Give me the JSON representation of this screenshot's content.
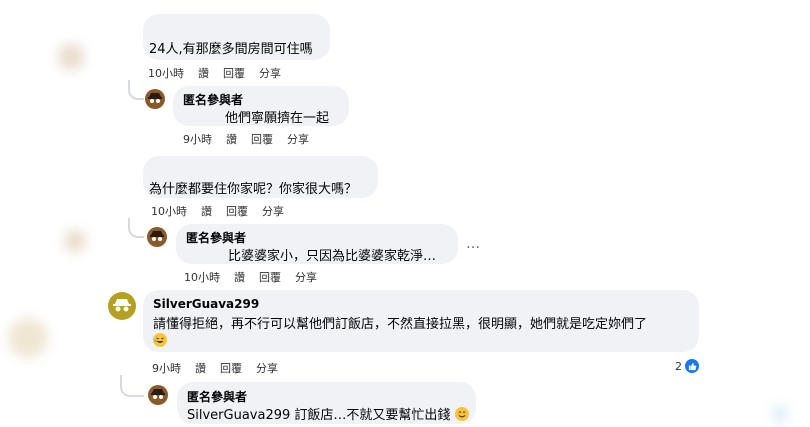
{
  "comments": [
    {
      "text": "24人,有那麼多間房間可住嗎",
      "time": "10小時",
      "like_label": "讚",
      "reply_label": "回覆",
      "share_label": "分享"
    },
    {
      "name": "匿名參與者",
      "text": "他們寧願擠在一起",
      "time": "9小時",
      "like_label": "讚",
      "reply_label": "回覆",
      "share_label": "分享"
    },
    {
      "text": "為什麼都要住你家呢？你家很大嗎？",
      "time": "10小時",
      "like_label": "讚",
      "reply_label": "回覆",
      "share_label": "分享"
    },
    {
      "name": "匿名參與者",
      "text": "比婆婆家小，只因為比婆婆家乾淨…",
      "time": "10小時",
      "like_label": "讚",
      "reply_label": "回覆",
      "share_label": "分享",
      "more": "…"
    },
    {
      "name": "SilverGuava299",
      "text": "請懂得拒絕，再不行可以幫他們訂飯店，不然直接拉黑，很明顯，她們就是吃定妳們了",
      "time": "9小時",
      "like_label": "讚",
      "reply_label": "回覆",
      "share_label": "分享",
      "likes": "2"
    },
    {
      "name": "匿名參與者",
      "text": "SilverGuava299 訂飯店…不就又要幫忙出錢"
    }
  ],
  "colors": {
    "bubble": "#f0f2f5",
    "like_blue": "#1877f2",
    "anon_avatar": "#8a5a2b",
    "silver_avatar": "#b5a022"
  },
  "icons": {
    "anonymous": "anonymous-spy-icon",
    "like": "thumbs-up-icon",
    "laugh": "laughing-emoji-icon",
    "smile": "smiling-emoji-icon"
  }
}
